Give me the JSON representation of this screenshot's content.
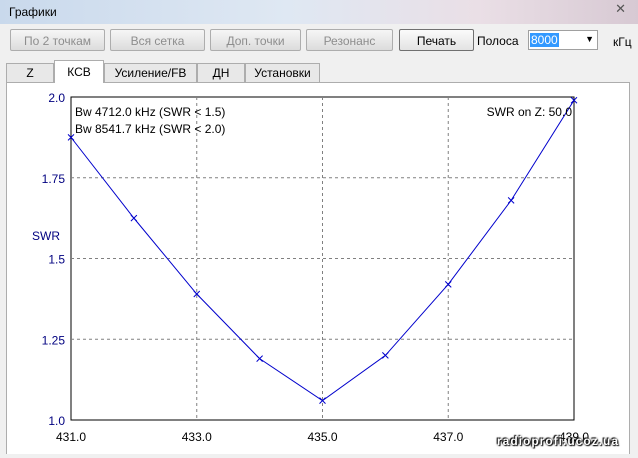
{
  "window": {
    "title": "Графики",
    "close_glyph": "✕"
  },
  "toolbar": {
    "buttons": [
      {
        "label": "По 2 точкам",
        "enabled": false
      },
      {
        "label": "Вся сетка",
        "enabled": false
      },
      {
        "label": "Доп. точки",
        "enabled": false
      },
      {
        "label": "Резонанс",
        "enabled": false
      },
      {
        "label": "Печать",
        "enabled": true
      }
    ],
    "band_label": "Полоса",
    "band_value": "8000",
    "band_unit": "кГц"
  },
  "tabs": [
    {
      "label": "Z",
      "selected": false
    },
    {
      "label": "КСВ",
      "selected": true
    },
    {
      "label": "Усиление/FB",
      "selected": false
    },
    {
      "label": "ДН",
      "selected": false
    },
    {
      "label": "Установки",
      "selected": false
    }
  ],
  "chart_data": {
    "type": "line",
    "ylabel": "SWR",
    "xlabel": "",
    "xlim": [
      431.0,
      439.0
    ],
    "ylim": [
      1.0,
      2.0
    ],
    "x_ticks": [
      "431.0",
      "433.0",
      "435.0",
      "437.0",
      "439.0"
    ],
    "y_ticks": [
      "1.0",
      "1.25",
      "1.5",
      "1.75",
      "2.0"
    ],
    "grid": true,
    "annotations": [
      "Bw 4712.0 kHz (SWR < 1.5)",
      "Bw 8541.7 kHz (SWR < 2.0)",
      "SWR on Z: 50.0"
    ],
    "series": [
      {
        "color": "#0000cc",
        "x": [
          431.0,
          432.0,
          433.0,
          434.0,
          435.0,
          436.0,
          437.0,
          438.0,
          439.0
        ],
        "y": [
          1.875,
          1.625,
          1.39,
          1.19,
          1.06,
          1.2,
          1.42,
          1.68,
          1.99
        ]
      }
    ]
  },
  "watermark": "radioprofi.ucoz.ua"
}
